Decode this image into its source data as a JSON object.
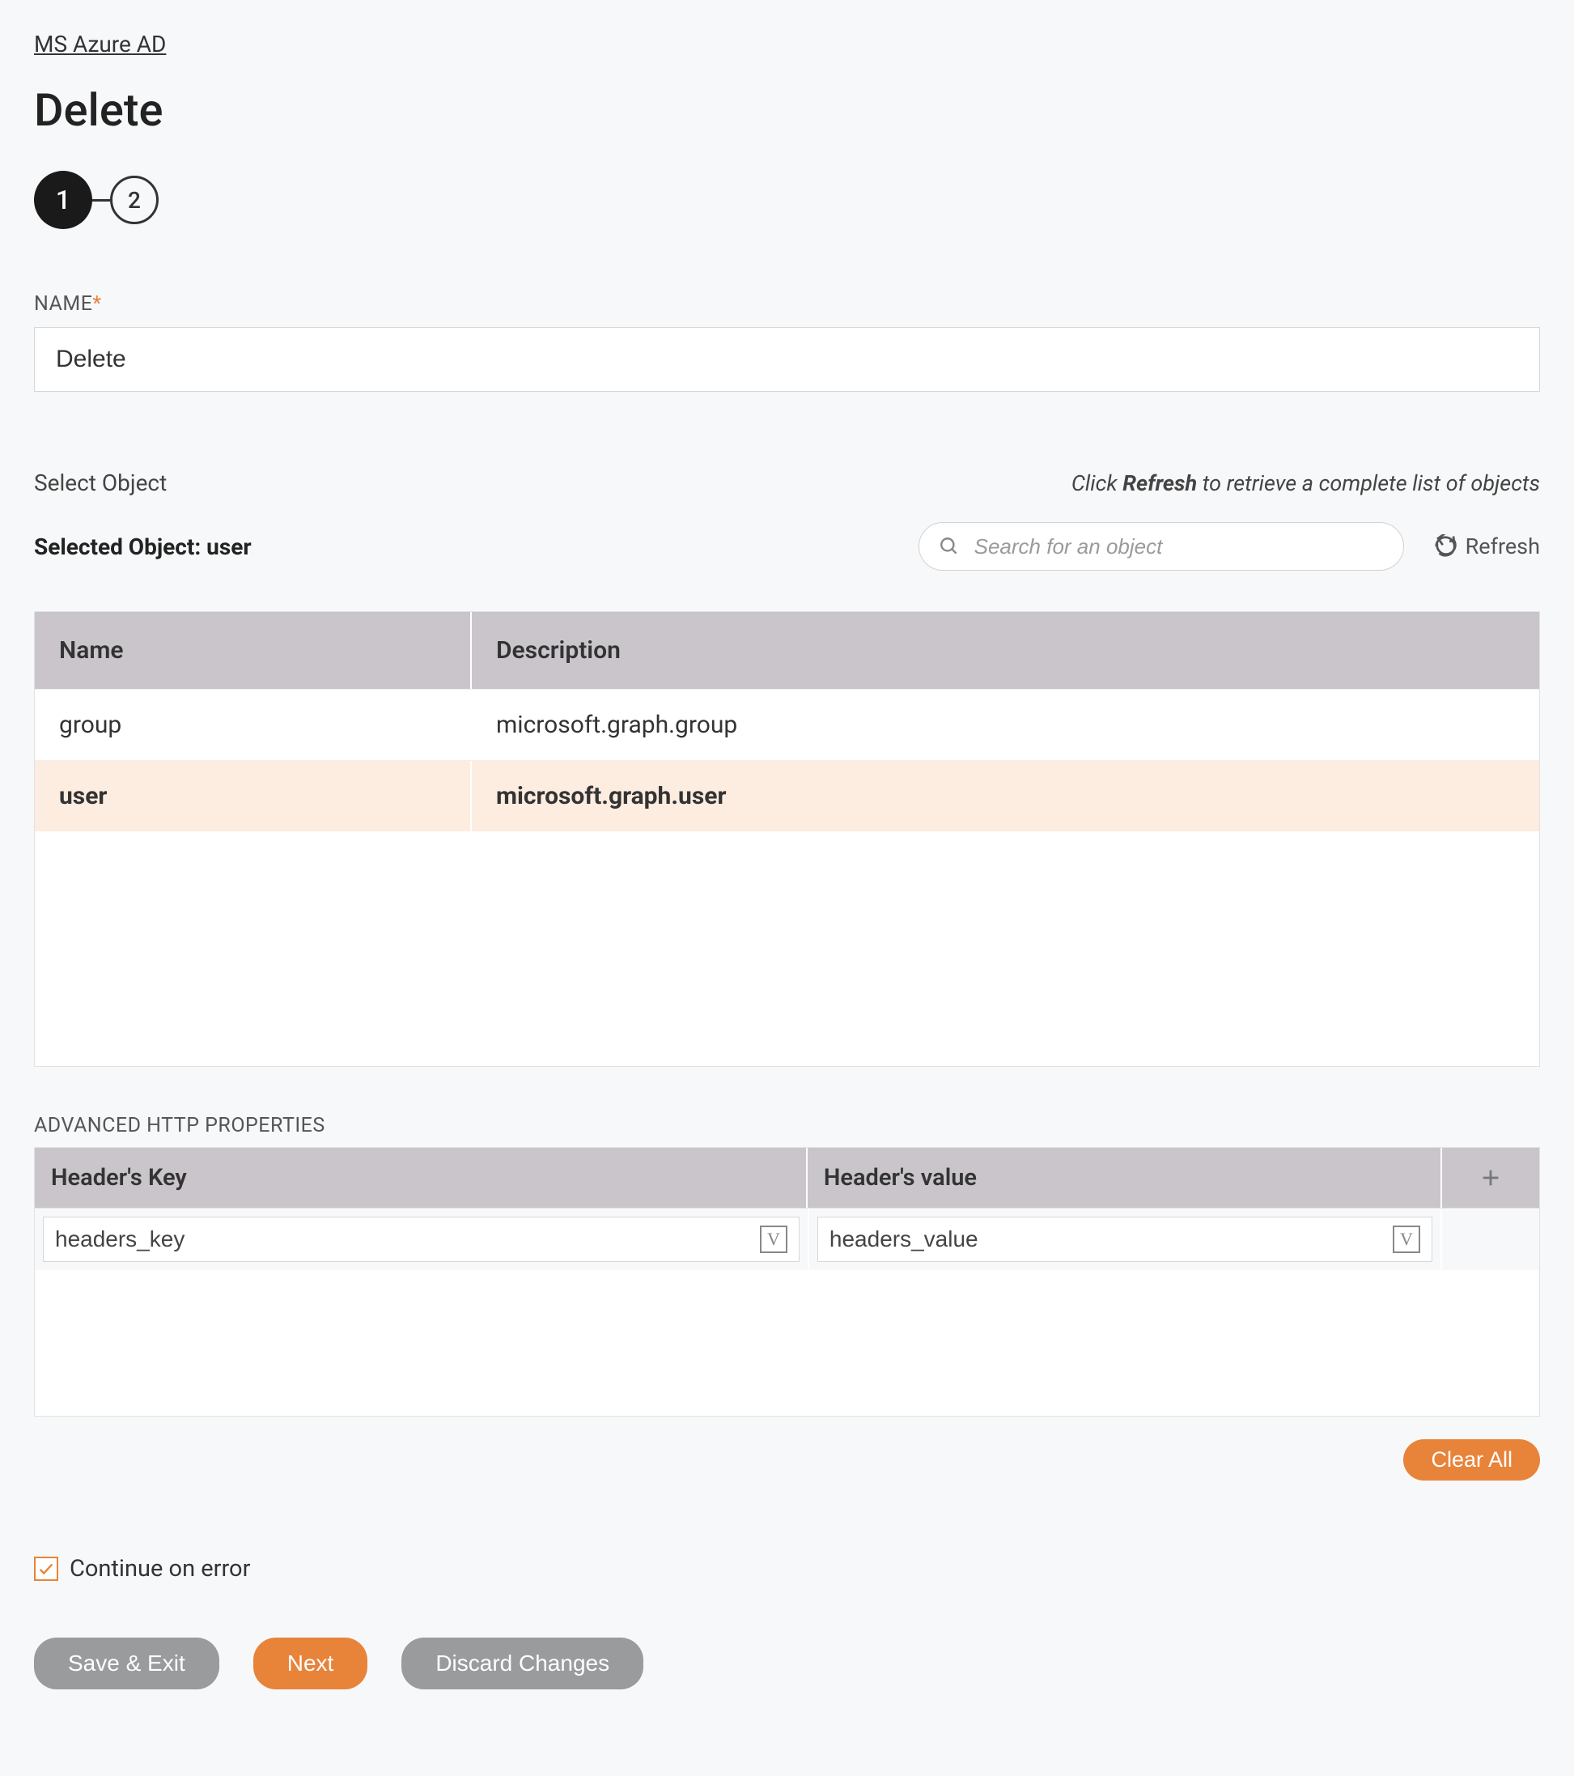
{
  "breadcrumb": "MS Azure AD",
  "page_title": "Delete",
  "stepper": {
    "step1": "1",
    "step2": "2"
  },
  "name_field": {
    "label": "NAME",
    "value": "Delete"
  },
  "select_object": {
    "label": "Select Object",
    "hint_prefix": "Click ",
    "hint_bold": "Refresh",
    "hint_suffix": " to retrieve a complete list of objects",
    "selected_prefix": "Selected Object: ",
    "selected_value": "user",
    "search_placeholder": "Search for an object",
    "refresh_label": "Refresh"
  },
  "object_table": {
    "headers": {
      "name": "Name",
      "description": "Description"
    },
    "rows": [
      {
        "name": "group",
        "description": "microsoft.graph.group",
        "selected": false
      },
      {
        "name": "user",
        "description": "microsoft.graph.user",
        "selected": true
      }
    ]
  },
  "advanced": {
    "label": "ADVANCED HTTP PROPERTIES",
    "headers": {
      "key": "Header's Key",
      "value": "Header's value"
    },
    "row": {
      "key": "headers_key",
      "value": "headers_value"
    }
  },
  "clear_all": "Clear All",
  "continue_on_error": {
    "label": "Continue on error",
    "checked": true
  },
  "buttons": {
    "save_exit": "Save & Exit",
    "next": "Next",
    "discard": "Discard Changes"
  }
}
